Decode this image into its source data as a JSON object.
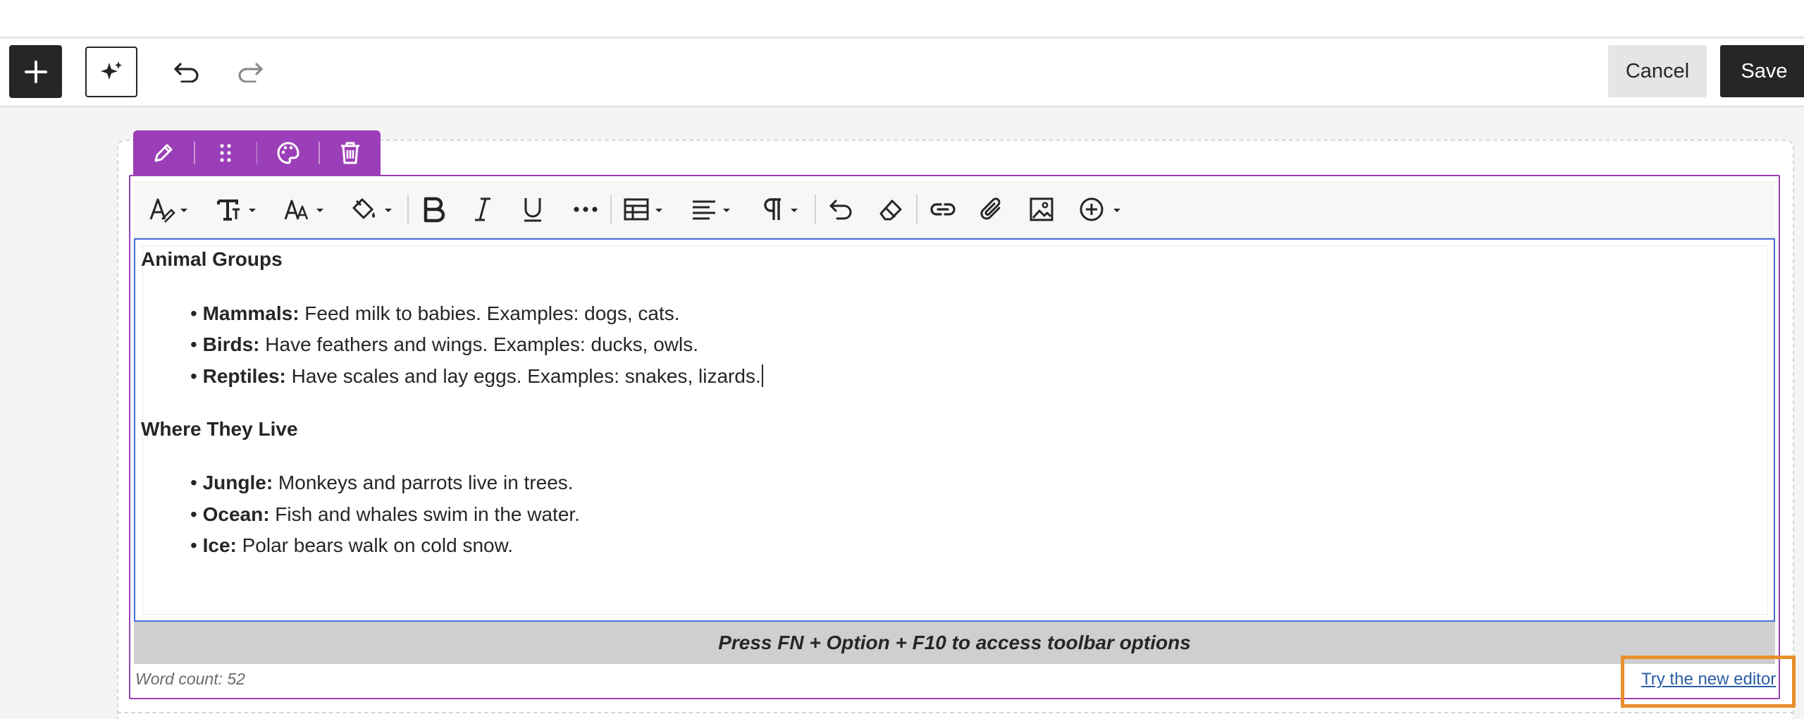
{
  "topbar": {
    "add_icon": "plus-icon",
    "assist_icon": "sparkle-icon",
    "undo_icon": "undo-icon",
    "redo_icon": "redo-icon",
    "cancel_label": "Cancel",
    "save_label": "Save"
  },
  "block_toolbar": {
    "items": [
      "pencil-icon",
      "drag-handle-icon",
      "palette-icon",
      "trash-icon"
    ],
    "accent_color": "#9b3fb8"
  },
  "format_toolbar": {
    "items": [
      "text-style-icon",
      "font-family-icon",
      "font-size-icon",
      "highlight-color-icon",
      "bold-icon",
      "italic-icon",
      "underline-icon",
      "more-icon",
      "table-icon",
      "align-icon",
      "paragraph-icon",
      "undo-icon",
      "eraser-icon",
      "link-icon",
      "attachment-icon",
      "image-icon",
      "insert-icon"
    ]
  },
  "content": {
    "heading1": "Animal Groups",
    "list1": [
      {
        "term": "Mammals:",
        "text": " Feed milk to babies. Examples: dogs, cats."
      },
      {
        "term": "Birds:",
        "text": " Have feathers and wings. Examples: ducks, owls."
      },
      {
        "term": "Reptiles:",
        "text": " Have scales and lay eggs. Examples: snakes, lizards."
      }
    ],
    "heading2": "Where They Live",
    "list2": [
      {
        "term": "Jungle:",
        "text": " Monkeys and parrots live in trees."
      },
      {
        "term": "Ocean:",
        "text": " Fish and whales swim in the water."
      },
      {
        "term": "Ice:",
        "text": " Polar bears walk on cold snow."
      }
    ]
  },
  "hint": "Press FN + Option + F10 to access toolbar options",
  "word_count": "Word count: 52",
  "try_new_editor": "Try the new editor",
  "colors": {
    "dark": "#262626",
    "focus_blue": "#4a6fd8",
    "highlight_orange": "#e98f2c",
    "link_blue": "#2b5ea8"
  }
}
